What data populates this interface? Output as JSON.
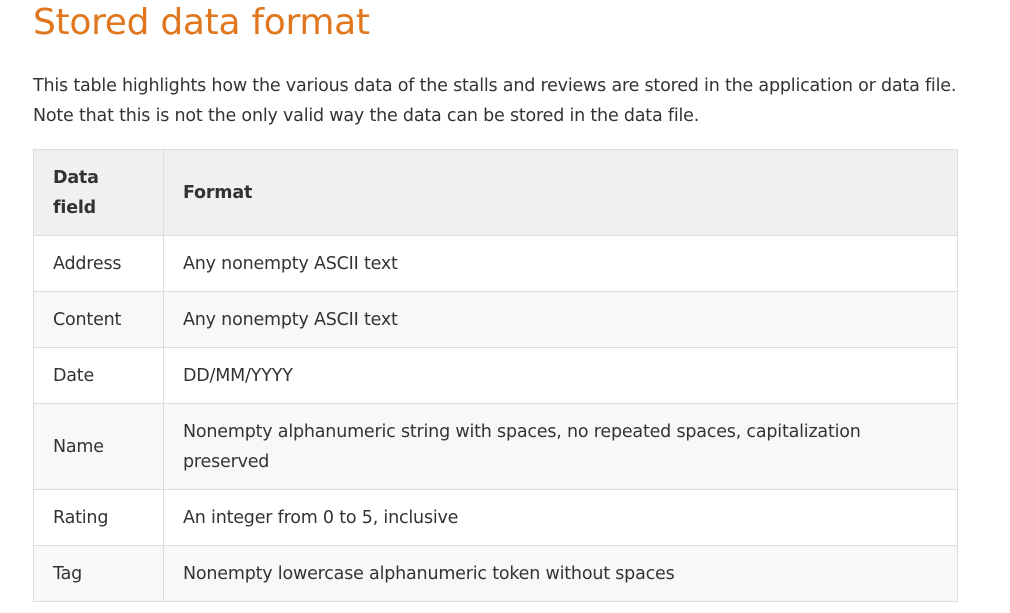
{
  "title": "Stored data format",
  "intro": "This table highlights how the various data of the stalls and reviews are stored in the application or data file. Note that this is not the only valid way the data can be stored in the data file.",
  "table": {
    "headers": [
      "Data field",
      "Format"
    ],
    "rows": [
      {
        "field": "Address",
        "format": "Any nonempty ASCII text"
      },
      {
        "field": "Content",
        "format": "Any nonempty ASCII text"
      },
      {
        "field": "Date",
        "format": "DD/MM/YYYY"
      },
      {
        "field": "Name",
        "format": "Nonempty alphanumeric string with spaces, no repeated spaces, capitalization preserved"
      },
      {
        "field": "Rating",
        "format": "An integer from 0 to 5, inclusive"
      },
      {
        "field": "Tag",
        "format": "Nonempty lowercase alphanumeric token without spaces"
      }
    ]
  },
  "colors": {
    "title": "#e0771e",
    "text": "#333333",
    "header_bg": "#f0f0f0",
    "border": "#dddddd"
  }
}
